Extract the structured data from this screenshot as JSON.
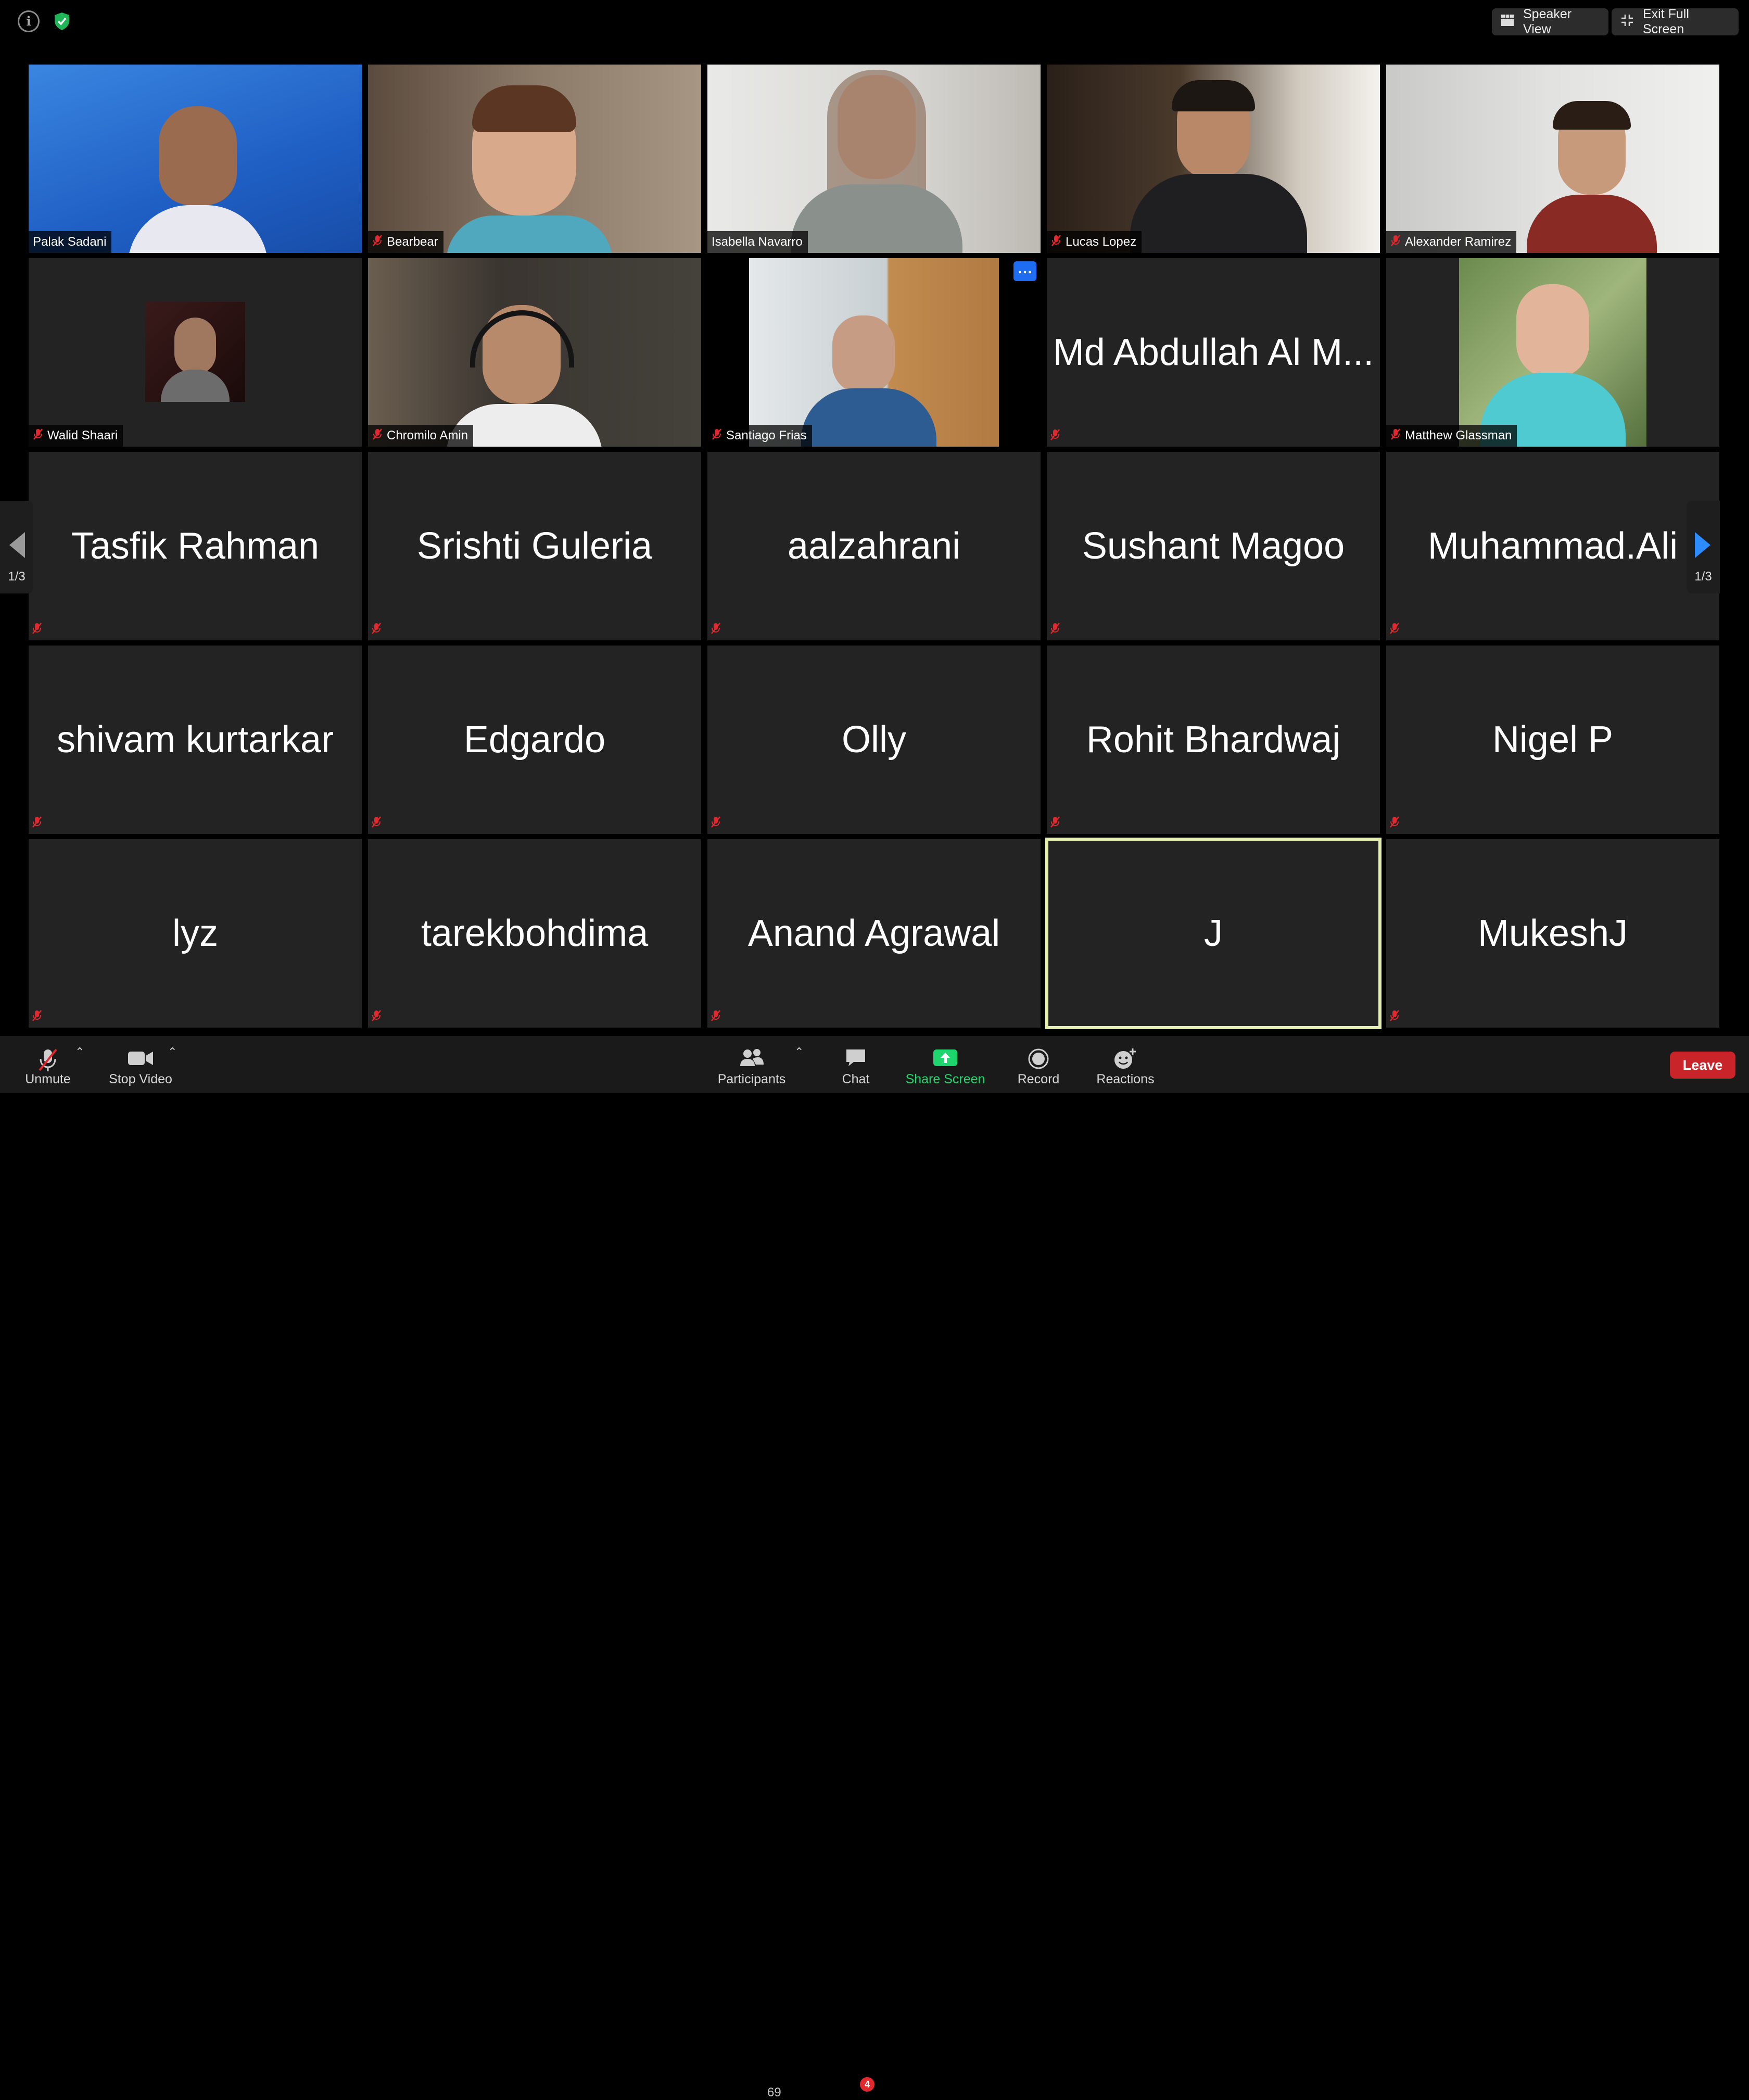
{
  "top_bar": {
    "speaker_view_label": "Speaker View",
    "exit_full_screen_label": "Exit Full Screen"
  },
  "participants": [
    {
      "name": "Palak Sadani",
      "video": true,
      "muted": false
    },
    {
      "name": "Bearbear",
      "video": true,
      "muted": true
    },
    {
      "name": "Isabella Navarro",
      "video": true,
      "muted": false
    },
    {
      "name": "Lucas Lopez",
      "video": true,
      "muted": true
    },
    {
      "name": "Alexander Ramirez",
      "video": true,
      "muted": true
    },
    {
      "name": "Walid Shaari",
      "video": "profile-photo",
      "muted": true
    },
    {
      "name": "Chromilo Amin",
      "video": true,
      "muted": true
    },
    {
      "name": "Santiago Frias",
      "video": true,
      "muted": true
    },
    {
      "name": "Md Abdullah Al M...",
      "video": false,
      "muted": true
    },
    {
      "name": "Matthew Glassman",
      "video": "profile-photo",
      "muted": true
    },
    {
      "name": "Tasfik Rahman",
      "video": false,
      "muted": true
    },
    {
      "name": "Srishti Guleria",
      "video": false,
      "muted": true
    },
    {
      "name": "aalzahrani",
      "video": false,
      "muted": true
    },
    {
      "name": "Sushant Magoo",
      "video": false,
      "muted": true
    },
    {
      "name": "Muhammad.Ali",
      "video": false,
      "muted": true
    },
    {
      "name": "shivam kurtarkar",
      "video": false,
      "muted": true
    },
    {
      "name": "Edgardo",
      "video": false,
      "muted": true
    },
    {
      "name": "Olly",
      "video": false,
      "muted": true
    },
    {
      "name": "Rohit Bhardwaj",
      "video": false,
      "muted": true
    },
    {
      "name": "Nigel P",
      "video": false,
      "muted": true
    },
    {
      "name": "lyz",
      "video": false,
      "muted": true
    },
    {
      "name": "tarekbohdima",
      "video": false,
      "muted": true
    },
    {
      "name": "Anand Agrawal",
      "video": false,
      "muted": true
    },
    {
      "name": "J",
      "video": false,
      "muted": false,
      "active_speaker": true
    },
    {
      "name": "MukeshJ",
      "video": false,
      "muted": true
    }
  ],
  "paging": {
    "left_label": "1/3",
    "right_label": "1/3"
  },
  "toolbar": {
    "unmute_label": "Unmute",
    "stop_video_label": "Stop Video",
    "participants_label": "Participants",
    "participants_count": "69",
    "chat_label": "Chat",
    "chat_badge": "4",
    "share_screen_label": "Share Screen",
    "record_label": "Record",
    "reactions_label": "Reactions",
    "leave_label": "Leave"
  },
  "colors": {
    "active_speaker_border": "#e4eeb0",
    "share_green": "#1fd66e",
    "leave_red": "#c8242a",
    "mute_red": "#e0282e"
  }
}
